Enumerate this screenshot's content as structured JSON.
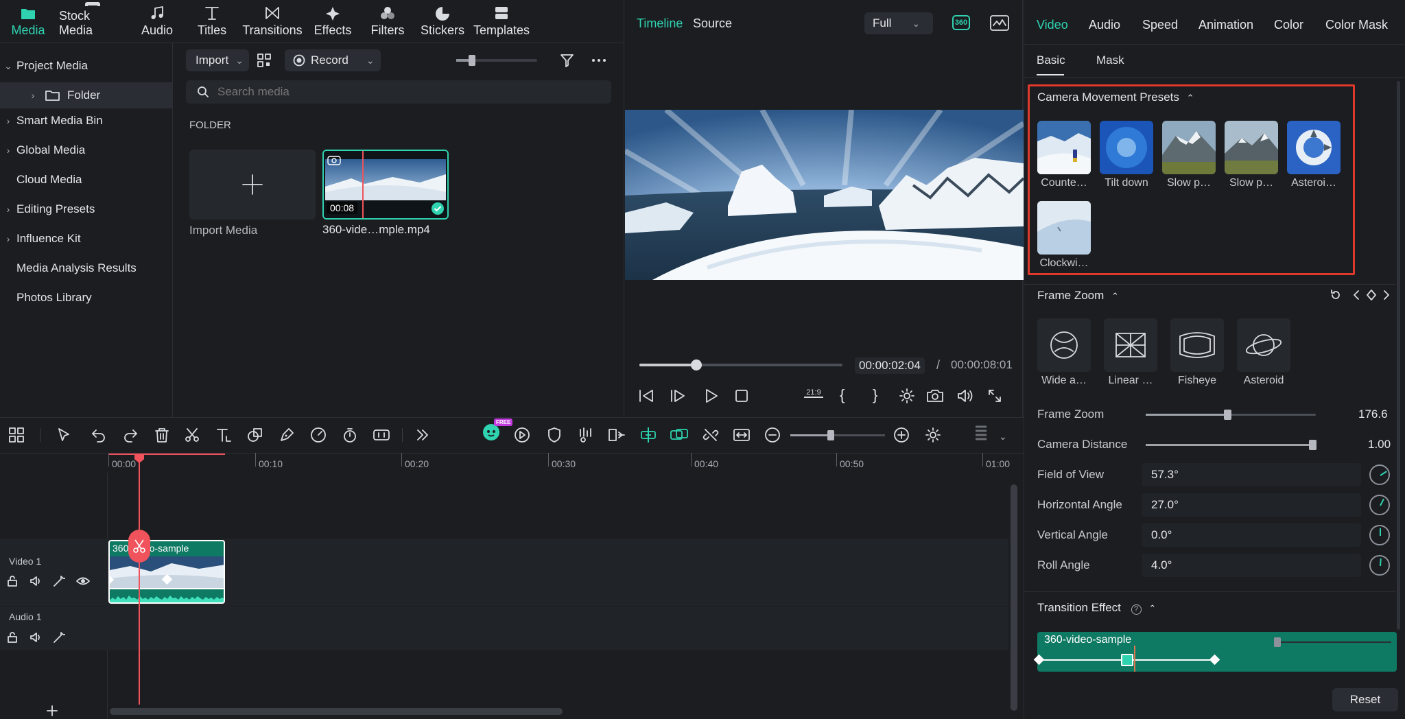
{
  "nav": {
    "tabs": [
      {
        "label": "Media",
        "icon": "media-icon"
      },
      {
        "label": "Stock Media",
        "icon": "stock-media-icon"
      },
      {
        "label": "Audio",
        "icon": "music-note-icon"
      },
      {
        "label": "Titles",
        "icon": "titles-t-icon"
      },
      {
        "label": "Transitions",
        "icon": "transitions-bowtie-icon"
      },
      {
        "label": "Effects",
        "icon": "effects-sparkle-icon"
      },
      {
        "label": "Filters",
        "icon": "filters-circles-icon"
      },
      {
        "label": "Stickers",
        "icon": "stickers-icon"
      },
      {
        "label": "Templates",
        "icon": "templates-icon"
      }
    ],
    "active": "Media"
  },
  "sidebar": {
    "items": [
      {
        "label": "Project Media",
        "expanded": true
      },
      {
        "label": "Folder",
        "selected": true
      },
      {
        "label": "Smart Media Bin"
      },
      {
        "label": "Global Media"
      },
      {
        "label": "Cloud Media"
      },
      {
        "label": "Editing Presets"
      },
      {
        "label": "Influence Kit"
      },
      {
        "label": "Media Analysis Results"
      },
      {
        "label": "Photos Library"
      }
    ]
  },
  "media": {
    "import_label": "Import",
    "record_label": "Record",
    "search_placeholder": "Search media",
    "section_label": "FOLDER",
    "import_media_label": "Import Media",
    "clip_name": "360-vide…mple.mp4",
    "clip_duration": "00:08"
  },
  "preview": {
    "tab_timeline": "Timeline",
    "tab_source": "Source",
    "quality": "Full",
    "badge_360": "360",
    "current_time": "00:00:02:04",
    "separator": "/",
    "total_time": "00:00:08:01",
    "aspect_label": "21:9",
    "playhead_fraction": 0.28
  },
  "props": {
    "tabs": [
      "Video",
      "Audio",
      "Speed",
      "Animation",
      "Color",
      "Color Mask"
    ],
    "active_tab": "Video",
    "subtabs": [
      "Basic",
      "Mask"
    ],
    "active_subtab": "Basic",
    "camera_section": "Camera Movement Presets",
    "presets": [
      "Counte…",
      "Tilt down",
      "Slow p…",
      "Slow p…",
      "Asteroi…",
      "Clockwi…"
    ],
    "frame_zoom_section": "Frame Zoom",
    "zoom_modes": [
      "Wide a…",
      "Linear …",
      "Fisheye",
      "Asteroid"
    ],
    "frame_zoom_label": "Frame Zoom",
    "frame_zoom_value": "176.6",
    "frame_zoom_fraction": 0.48,
    "camera_distance_label": "Camera Distance",
    "camera_distance_value": "1.00",
    "camera_distance_fraction": 0.98,
    "fov_label": "Field of View",
    "fov_value": "57.3°",
    "h_angle_label": "Horizontal Angle",
    "h_angle_value": "27.0°",
    "v_angle_label": "Vertical Angle",
    "v_angle_value": "0.0°",
    "roll_label": "Roll Angle",
    "roll_value": "4.0°",
    "transition_section": "Transition Effect",
    "transition_clip": "360-video-sample",
    "reset_label": "Reset"
  },
  "timeline": {
    "ruler": [
      "00:00",
      "00:10",
      "00:20",
      "00:30",
      "00:40",
      "00:50",
      "01:00"
    ],
    "track_video": "Video 1",
    "track_audio": "Audio 1",
    "clip_label": "360-video-sample",
    "free_badge": "FREE"
  },
  "colors": {
    "accent": "#2fd3b0",
    "highlight": "#e0392b",
    "playhead": "#f0535b",
    "clip": "#0f7a63"
  }
}
